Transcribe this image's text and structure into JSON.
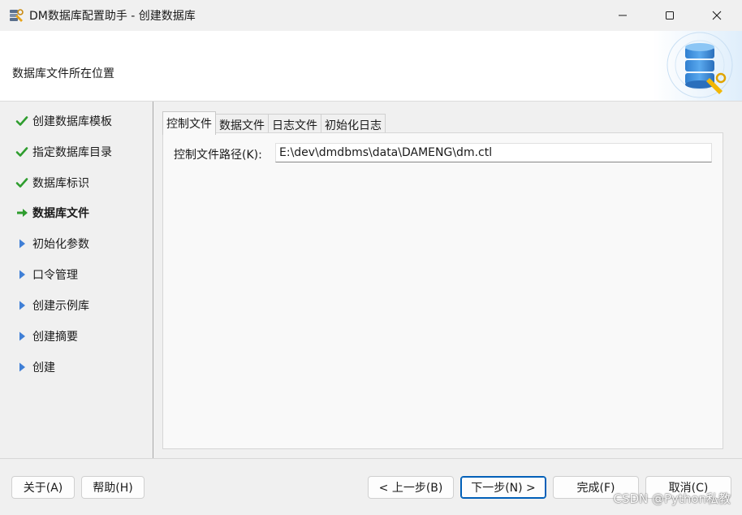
{
  "window": {
    "title": "DM数据库配置助手 - 创建数据库",
    "controls": [
      "minimize-icon",
      "maximize-icon",
      "close-icon"
    ]
  },
  "header": {
    "subtitle": "数据库文件所在位置",
    "logo_icon": "database-tools-icon"
  },
  "sidebar": {
    "steps": [
      {
        "label": "创建数据库模板",
        "status": "done",
        "icon": "checkmark-icon"
      },
      {
        "label": "指定数据库目录",
        "status": "done",
        "icon": "checkmark-icon"
      },
      {
        "label": "数据库标识",
        "status": "done",
        "icon": "checkmark-icon"
      },
      {
        "label": "数据库文件",
        "status": "current",
        "icon": "arrow-right-icon"
      },
      {
        "label": "初始化参数",
        "status": "pending",
        "icon": "triangle-right-icon"
      },
      {
        "label": "口令管理",
        "status": "pending",
        "icon": "triangle-right-icon"
      },
      {
        "label": "创建示例库",
        "status": "pending",
        "icon": "triangle-right-icon"
      },
      {
        "label": "创建摘要",
        "status": "pending",
        "icon": "triangle-right-icon"
      },
      {
        "label": "创建",
        "status": "pending",
        "icon": "triangle-right-icon"
      }
    ]
  },
  "tabs": [
    {
      "label": "控制文件",
      "active": true
    },
    {
      "label": "数据文件",
      "active": false
    },
    {
      "label": "日志文件",
      "active": false
    },
    {
      "label": "初始化日志",
      "active": false
    }
  ],
  "control_file": {
    "path_label": "控制文件路径(K):",
    "path_value": "E:\\dev\\dmdbms\\data\\DAMENG\\dm.ctl"
  },
  "buttons": {
    "about": "关于(A)",
    "help": "帮助(H)",
    "back": "< 上一步(B)",
    "next": "下一步(N) >",
    "finish": "完成(F)",
    "cancel": "取消(C)"
  },
  "watermark": "CSDN @Python私教",
  "colors": {
    "check": "#2e9d2e",
    "arrow": "#2e9d2e",
    "triangle": "#3f7fd6",
    "primary_border": "#005fb8"
  }
}
